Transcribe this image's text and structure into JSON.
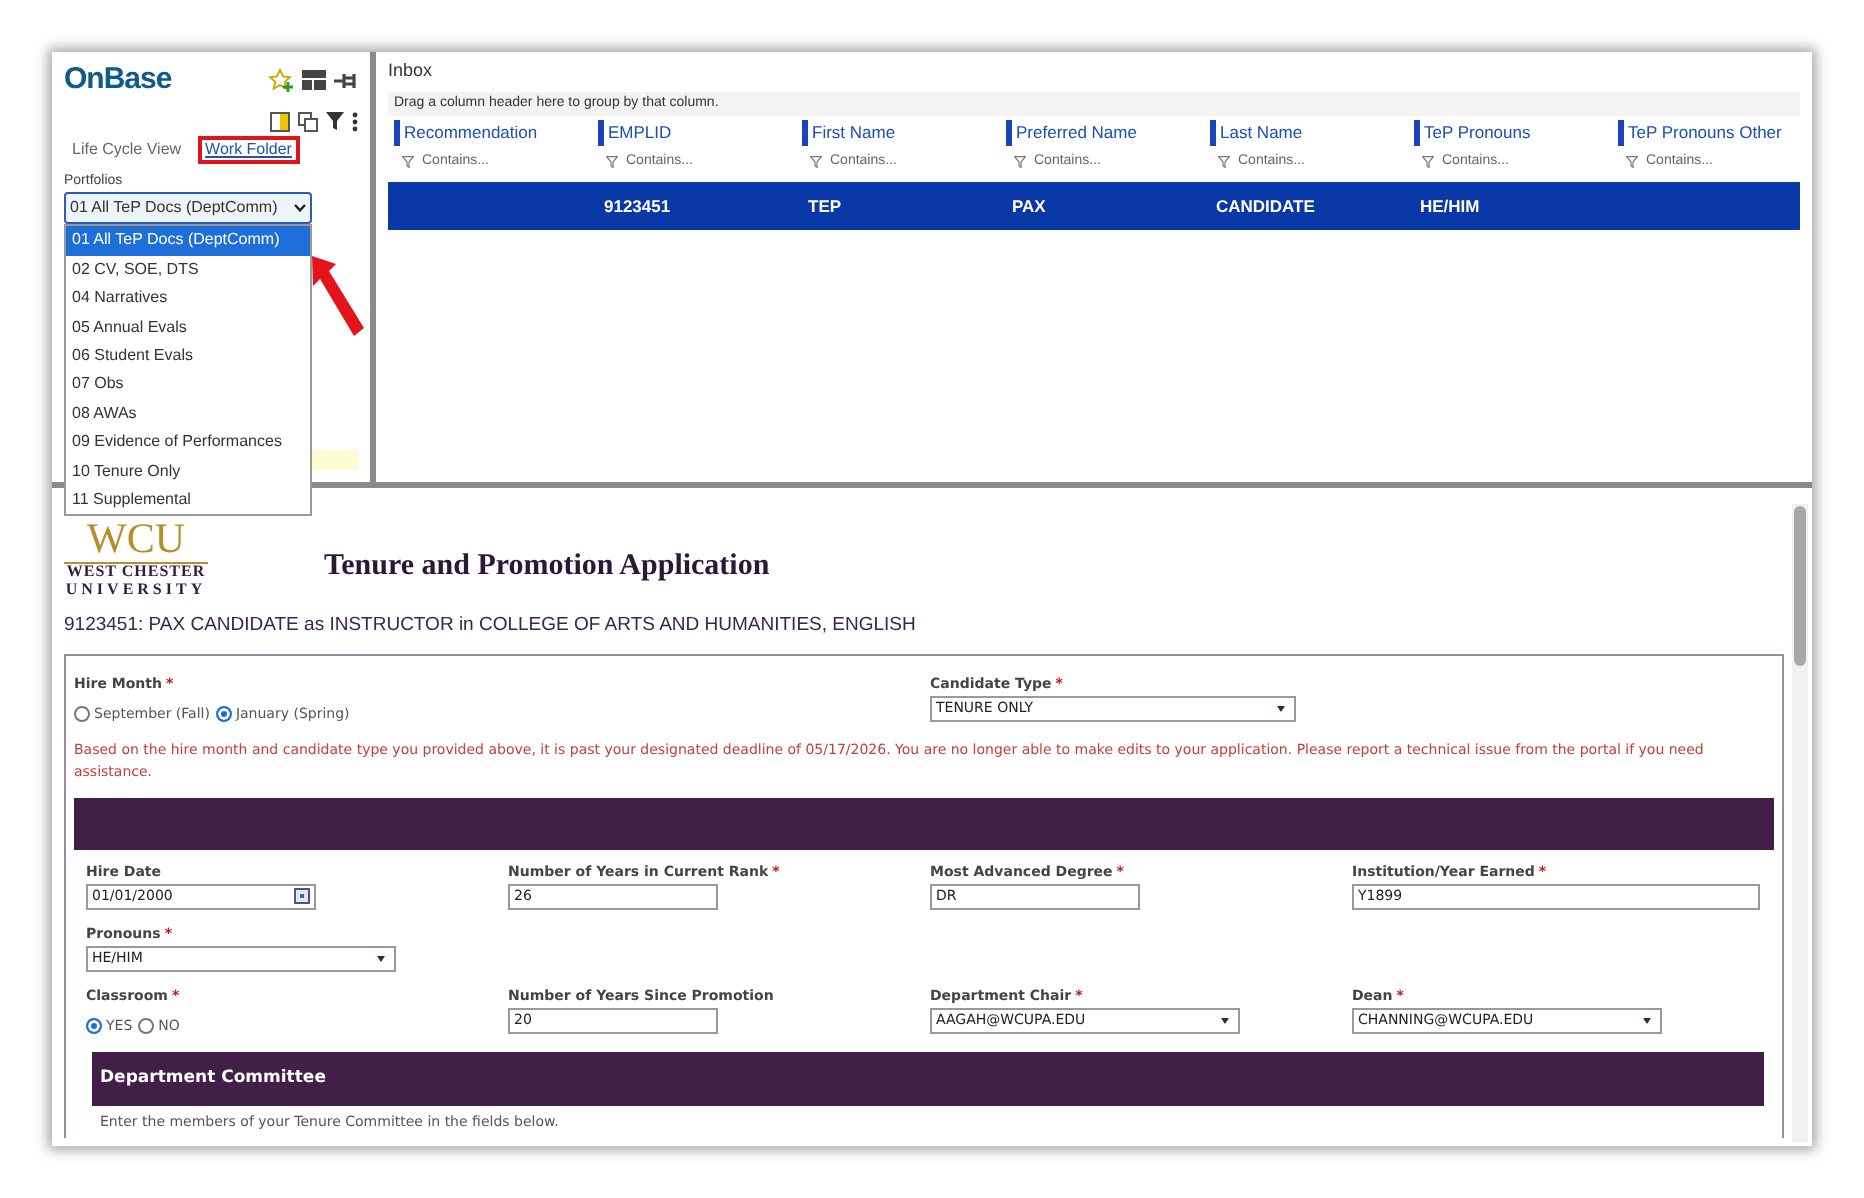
{
  "app": {
    "logo": "OnBase"
  },
  "sidebar": {
    "tabs": [
      {
        "label": "Life Cycle View",
        "selected": false,
        "highlighted": false
      },
      {
        "label": "Work Folder",
        "selected": true,
        "highlighted": true
      }
    ],
    "portfolios_label": "Portfolios",
    "portfolio_select": {
      "value": "01 All TeP Docs (DeptComm)",
      "expanded": true
    },
    "portfolio_options": [
      {
        "label": "01 All TeP Docs (DeptComm)",
        "selected": true
      },
      {
        "label": "02 CV, SOE, DTS",
        "selected": false
      },
      {
        "label": "04 Narratives",
        "selected": false
      },
      {
        "label": "05 Annual Evals",
        "selected": false
      },
      {
        "label": "06 Student Evals",
        "selected": false
      },
      {
        "label": "07 Obs",
        "selected": false
      },
      {
        "label": "08 AWAs",
        "selected": false
      },
      {
        "label": "09 Evidence of Performances",
        "selected": false
      },
      {
        "label": "10 Tenure Only",
        "selected": false
      },
      {
        "label": "11 Supplemental",
        "selected": false
      }
    ],
    "callout_arrow": true
  },
  "inbox": {
    "title": "Inbox",
    "group_hint": "Drag a column header here to group by that column.",
    "columns": [
      {
        "label": "Recommendation",
        "filter_placeholder": "Contains..."
      },
      {
        "label": "EMPLID",
        "filter_placeholder": "Contains..."
      },
      {
        "label": "First Name",
        "filter_placeholder": "Contains..."
      },
      {
        "label": "Preferred Name",
        "filter_placeholder": "Contains..."
      },
      {
        "label": "Last Name",
        "filter_placeholder": "Contains..."
      },
      {
        "label": "TeP Pronouns",
        "filter_placeholder": "Contains..."
      },
      {
        "label": "TeP Pronouns Other",
        "filter_placeholder": "Contains..."
      }
    ],
    "rows": [
      {
        "cells": [
          null,
          "9123451",
          "TEP",
          "PAX",
          "CANDIDATE",
          "HE/HIM",
          null
        ],
        "selected": true
      }
    ]
  },
  "form": {
    "logo": {
      "initials": "WCU",
      "line_1": "WEST CHESTER",
      "line_2": "UNIVERSITY"
    },
    "title": "Tenure and Promotion Application",
    "subtitle": "9123451: PAX CANDIDATE as INSTRUCTOR in COLLEGE OF ARTS AND HUMANITIES, ENGLISH",
    "required_mark": "*",
    "hire_month": {
      "label": "Hire Month",
      "required": true,
      "options": [
        {
          "label": "September (Fall)",
          "selected": false
        },
        {
          "label": "January (Spring)",
          "selected": true
        }
      ]
    },
    "candidate_type": {
      "label": "Candidate Type",
      "required": true,
      "value": "TENURE ONLY"
    },
    "warning": "Based on the hire month and candidate type you provided above, it is past your designated deadline of 05/17/2026. You are no longer able to make edits to your application. Please report a technical issue from the portal if you need assistance.",
    "field_rows": [
      [
        {
          "kind": "date",
          "label": "Hire Date",
          "required": false,
          "value": "01/01/2000"
        },
        {
          "kind": "text",
          "label": "Number of Years in Current Rank",
          "required": true,
          "value": "26"
        },
        {
          "kind": "text",
          "label": "Most Advanced Degree",
          "required": true,
          "value": "DR"
        },
        {
          "kind": "text",
          "label": "Institution/Year Earned",
          "required": true,
          "value": "Y1899"
        }
      ],
      [
        {
          "kind": "select",
          "label": "Pronouns",
          "required": true,
          "value": "HE/HIM"
        }
      ],
      [
        {
          "kind": "radio",
          "label": "Classroom",
          "required": true,
          "options": [
            {
              "label": "YES",
              "selected": true
            },
            {
              "label": "NO",
              "selected": false
            }
          ]
        },
        {
          "kind": "text",
          "label": "Number of Years Since Promotion",
          "required": false,
          "value": "20"
        },
        {
          "kind": "select",
          "label": "Department Chair",
          "required": true,
          "value": "AAGAH@WCUPA.EDU"
        },
        {
          "kind": "select",
          "label": "Dean",
          "required": true,
          "value": "CHANNING@WCUPA.EDU"
        }
      ]
    ],
    "section": {
      "title": "Department Committee",
      "instructions": "Enter the members of your Tenure Committee in the fields below."
    }
  }
}
